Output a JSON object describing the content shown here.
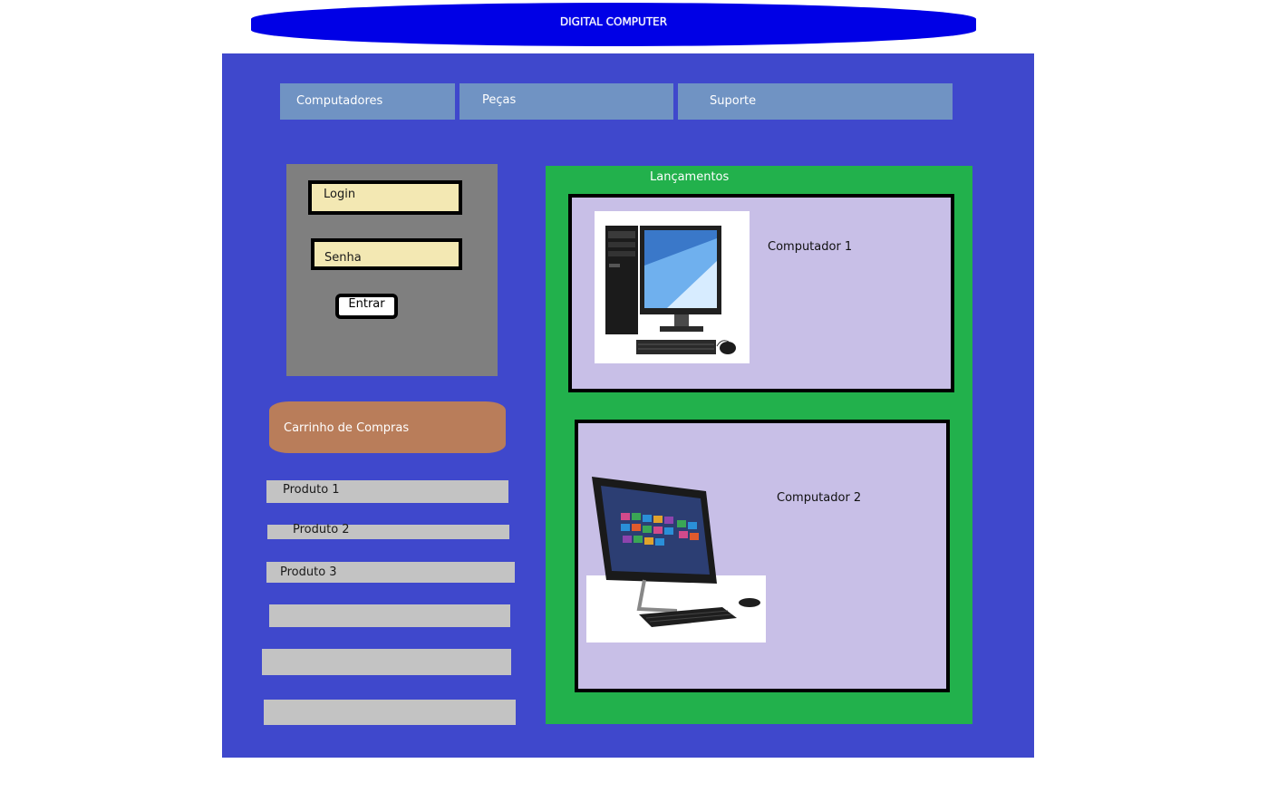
{
  "header": {
    "title": "DIGITAL COMPUTER"
  },
  "nav": {
    "computers": "Computadores",
    "parts": "Peças",
    "support": "Suporte"
  },
  "login": {
    "login_label": "Login",
    "password_label": "Senha",
    "submit_label": "Entrar"
  },
  "cart": {
    "title": "Carrinho de Compras",
    "products": [
      "Produto 1",
      "Produto 2",
      "Produto 3",
      "",
      "",
      ""
    ]
  },
  "launches": {
    "title": "Lançamentos",
    "items": [
      {
        "name": "Computador 1"
      },
      {
        "name": "Computador 2"
      }
    ]
  },
  "colors": {
    "header": "#0000e6",
    "main": "#3f48cc",
    "nav": "#7093c3",
    "launches": "#22b14c",
    "card": "#c8bfe7",
    "cart": "#b97d5a"
  }
}
